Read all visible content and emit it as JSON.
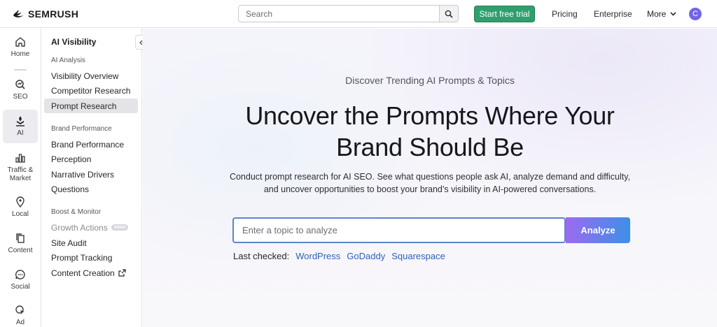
{
  "topbar": {
    "brand": "SEMRUSH",
    "search_placeholder": "Search",
    "trial_label": "Start free trial",
    "pricing_label": "Pricing",
    "enterprise_label": "Enterprise",
    "more_label": "More",
    "avatar_initial": "C",
    "accent_color": "#2f9f6e"
  },
  "rail": {
    "items": [
      {
        "label": "Home",
        "icon": "home-icon"
      },
      {
        "label": "SEO",
        "icon": "seo-icon"
      },
      {
        "label": "AI",
        "icon": "ai-icon",
        "active": true
      },
      {
        "label": "Traffic & Market",
        "icon": "bar-chart-icon"
      },
      {
        "label": "Local",
        "icon": "location-pin-icon"
      },
      {
        "label": "Content",
        "icon": "content-icon"
      },
      {
        "label": "Social",
        "icon": "chat-icon"
      },
      {
        "label": "Ad",
        "icon": "ad-cursor-icon"
      }
    ]
  },
  "sidebar": {
    "title": "AI Visibility",
    "sections": [
      {
        "label": "AI Analysis",
        "items": [
          "Visibility Overview",
          "Competitor Research",
          "Prompt Research"
        ]
      },
      {
        "label": "Brand Performance",
        "items": [
          "Brand Performance",
          "Perception",
          "Narrative Drivers",
          "Questions"
        ]
      },
      {
        "label": "Boost & Monitor",
        "items": [
          "Growth Actions",
          "Site Audit",
          "Prompt Tracking",
          "Content Creation"
        ]
      }
    ],
    "active_item": "Prompt Research",
    "soon_badge": "soon"
  },
  "main": {
    "eyebrow": "Discover Trending AI Prompts & Topics",
    "headline": "Uncover the Prompts Where Your Brand Should Be",
    "description": "Conduct prompt research for AI SEO. See what questions people ask AI, analyze demand and difficulty, and uncover opportunities to boost your brand’s visibility in AI-powered conversations.",
    "input_placeholder": "Enter a topic to analyze",
    "input_value": "",
    "analyze_label": "Analyze",
    "last_checked_label": "Last checked:",
    "last_checked_links": [
      "WordPress",
      "GoDaddy",
      "Squarespace"
    ]
  }
}
